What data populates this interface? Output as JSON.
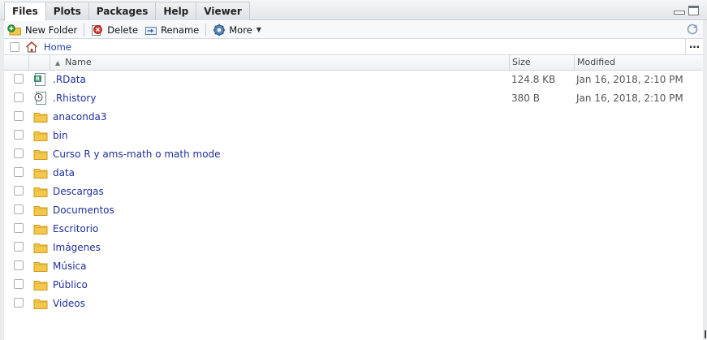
{
  "tabs": [
    {
      "label": "Files",
      "active": true
    },
    {
      "label": "Plots",
      "active": false
    },
    {
      "label": "Packages",
      "active": false
    },
    {
      "label": "Help",
      "active": false
    },
    {
      "label": "Viewer",
      "active": false
    }
  ],
  "toolbar": {
    "new_folder": "New Folder",
    "delete": "Delete",
    "rename": "Rename",
    "more": "More"
  },
  "breadcrumb": {
    "home": "Home",
    "more": "…"
  },
  "columns": {
    "name": "Name",
    "size": "Size",
    "modified": "Modified"
  },
  "files": [
    {
      "name": ".RData",
      "size": "124.8 KB",
      "modified": "Jan 16, 2018, 2:10 PM",
      "icon": "rdata-file-icon"
    },
    {
      "name": ".Rhistory",
      "size": "380 B",
      "modified": "Jan 16, 2018, 2:10 PM",
      "icon": "history-file-icon"
    },
    {
      "name": "anaconda3",
      "size": "",
      "modified": "",
      "icon": "folder-icon"
    },
    {
      "name": "bin",
      "size": "",
      "modified": "",
      "icon": "folder-icon"
    },
    {
      "name": "Curso R y ams-math o math mode",
      "size": "",
      "modified": "",
      "icon": "folder-icon"
    },
    {
      "name": "data",
      "size": "",
      "modified": "",
      "icon": "folder-icon"
    },
    {
      "name": "Descargas",
      "size": "",
      "modified": "",
      "icon": "folder-icon"
    },
    {
      "name": "Documentos",
      "size": "",
      "modified": "",
      "icon": "folder-icon"
    },
    {
      "name": "Escritorio",
      "size": "",
      "modified": "",
      "icon": "folder-icon"
    },
    {
      "name": "Imágenes",
      "size": "",
      "modified": "",
      "icon": "folder-icon"
    },
    {
      "name": "Música",
      "size": "",
      "modified": "",
      "icon": "folder-icon"
    },
    {
      "name": "Público",
      "size": "",
      "modified": "",
      "icon": "folder-icon"
    },
    {
      "name": "Videos",
      "size": "",
      "modified": "",
      "icon": "folder-icon"
    }
  ],
  "colors": {
    "link": "#1f2f9e",
    "folder": "#f3c84b",
    "folder_edge": "#c99a1e"
  }
}
